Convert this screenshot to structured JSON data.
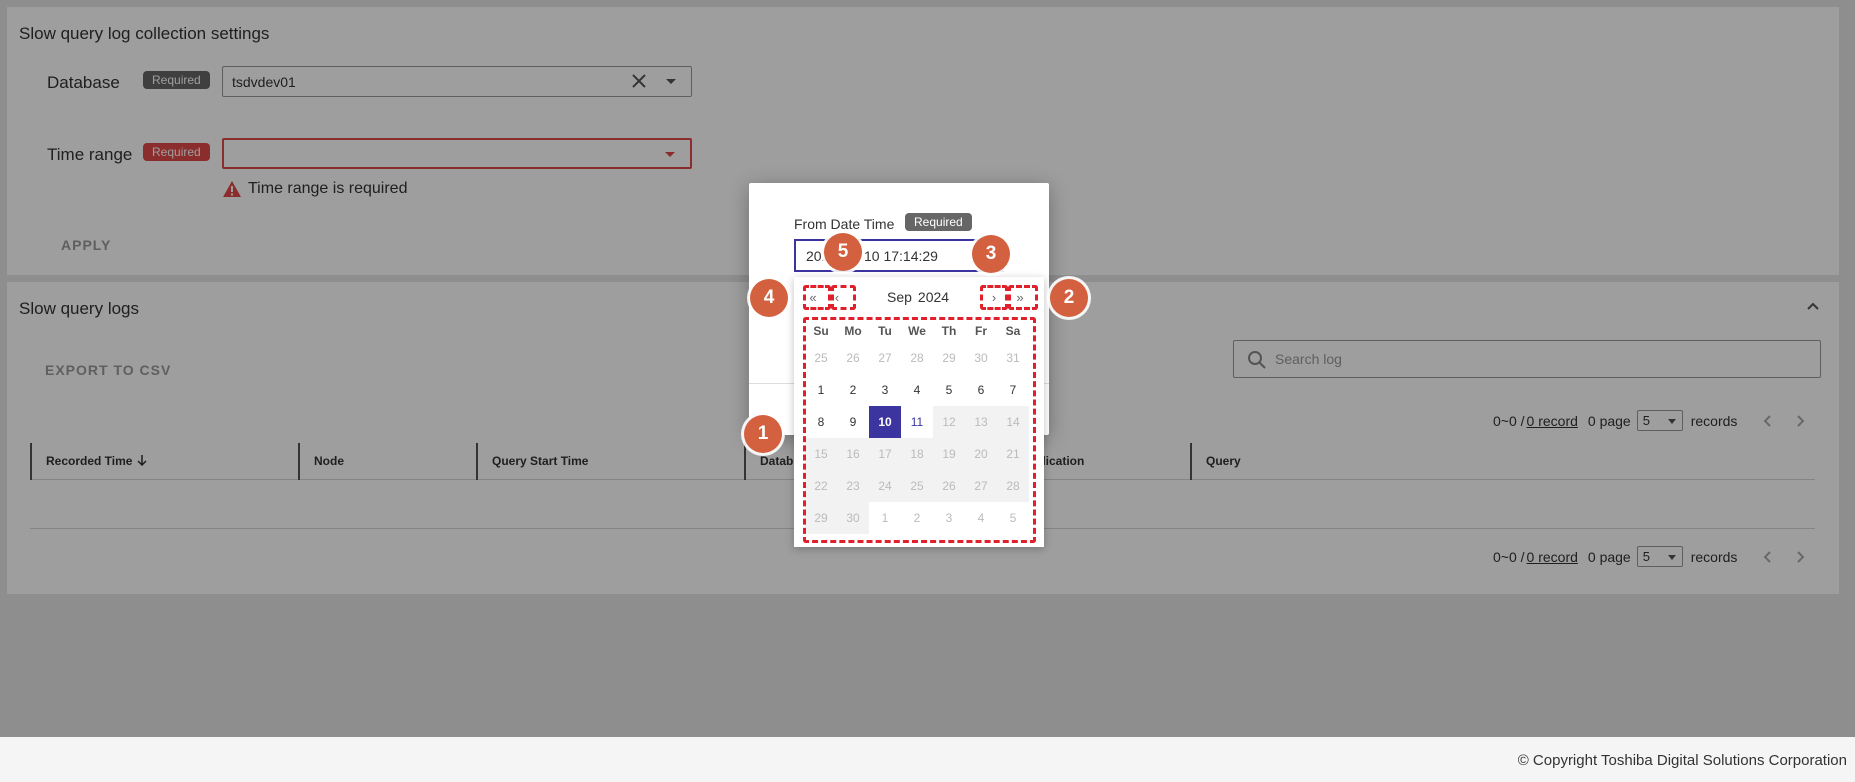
{
  "settings": {
    "title": "Slow query log collection settings",
    "database_label": "Database",
    "database_badge": "Required",
    "database_value": "tsdvdev01",
    "time_range_label": "Time range",
    "time_range_badge": "Required",
    "time_range_error": "Time range is required",
    "apply_label": "APPLY"
  },
  "logs": {
    "title": "Slow query logs",
    "export_label": "EXPORT TO CSV",
    "search_placeholder": "Search log",
    "columns": [
      "Recorded Time",
      "Node",
      "Query Start Time",
      "Datab",
      "plication",
      "Query"
    ],
    "pager": {
      "range": "0~0 /",
      "records_link": "0 record",
      "page": "0 page",
      "size": "5",
      "records": "records"
    }
  },
  "dialog": {
    "label": "From Date Time",
    "badge": "Required",
    "value_left": "202",
    "value_right": "10 17:14:29"
  },
  "calendar": {
    "month": "Sep",
    "year": "2024",
    "prev_year": "«",
    "prev_month": "‹",
    "next_month": "›",
    "next_year": "»",
    "weekdays": [
      "Su",
      "Mo",
      "Tu",
      "We",
      "Th",
      "Fr",
      "Sa"
    ],
    "weeks": [
      [
        "25",
        "26",
        "27",
        "28",
        "29",
        "30",
        "31"
      ],
      [
        "1",
        "2",
        "3",
        "4",
        "5",
        "6",
        "7"
      ],
      [
        "8",
        "9",
        "10",
        "11",
        "12",
        "13",
        "14"
      ],
      [
        "15",
        "16",
        "17",
        "18",
        "19",
        "20",
        "21"
      ],
      [
        "22",
        "23",
        "24",
        "25",
        "26",
        "27",
        "28"
      ],
      [
        "29",
        "30",
        "1",
        "2",
        "3",
        "4",
        "5"
      ]
    ]
  },
  "markers": [
    "1",
    "2",
    "3",
    "4",
    "5"
  ],
  "footer": {
    "copyright": "© Copyright Toshiba Digital Solutions Corporation"
  },
  "colors": {
    "accent": "#3c35a0",
    "error": "#e04a4a",
    "marker": "#d3603e",
    "highlight": "#e0202a"
  }
}
